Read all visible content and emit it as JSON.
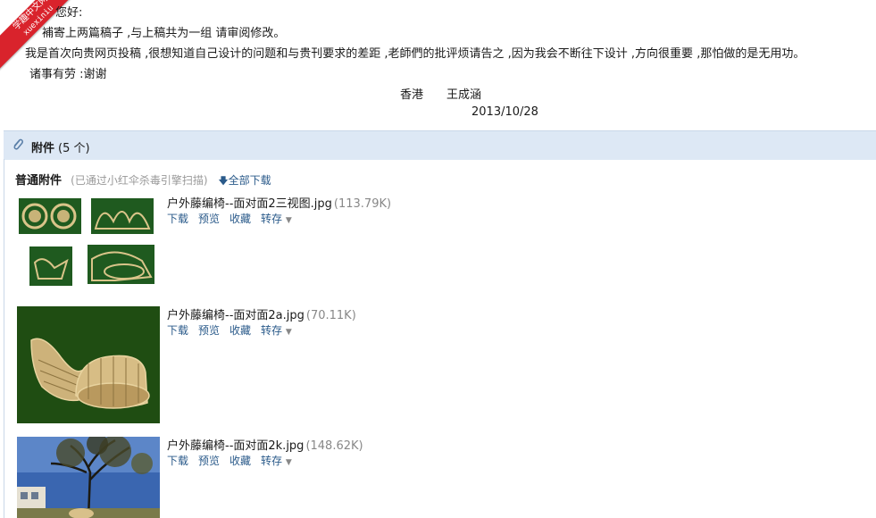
{
  "watermark": {
    "text": "学趣中文网",
    "brand": "xuexiniu"
  },
  "letter": {
    "greeting": "您好:",
    "line1": "補寄上两篇稿子 ,与上稿共为一组 请审阅修改。",
    "line2": "我是首次向贵网页投稿 ,很想知道自己设计的问题和与贵刊要求的差距 ,老師們的批评烦请告之 ,因为我会不断往下设计 ,方向很重要 ,那怕做的是无用功。",
    "line3": "诸事有劳 :谢谢",
    "sign_place": "香港",
    "sign_name": "王成涵",
    "date": "2013/10/28"
  },
  "attachments": {
    "title": "附件",
    "count": "(5 个)",
    "section_label": "普通附件",
    "scan_note": "(已通过小红伞杀毒引擎扫描)",
    "download_all": "全部下载",
    "actions": {
      "download": "下载",
      "preview": "预览",
      "favorite": "收藏",
      "forward": "转存"
    },
    "items": [
      {
        "name": "户外藤编椅--面对面2三视图.jpg",
        "size": "(113.79K)"
      },
      {
        "name": "户外藤编椅--面对面2a.jpg",
        "size": "(70.11K)"
      },
      {
        "name": "户外藤编椅--面对面2k.jpg",
        "size": "(148.62K)"
      }
    ]
  },
  "colors": {
    "header_bg": "#dde8f5",
    "link": "#2a5a8a",
    "thumb_green": "#1f5a1f",
    "watermark_red": "#d9232c"
  }
}
